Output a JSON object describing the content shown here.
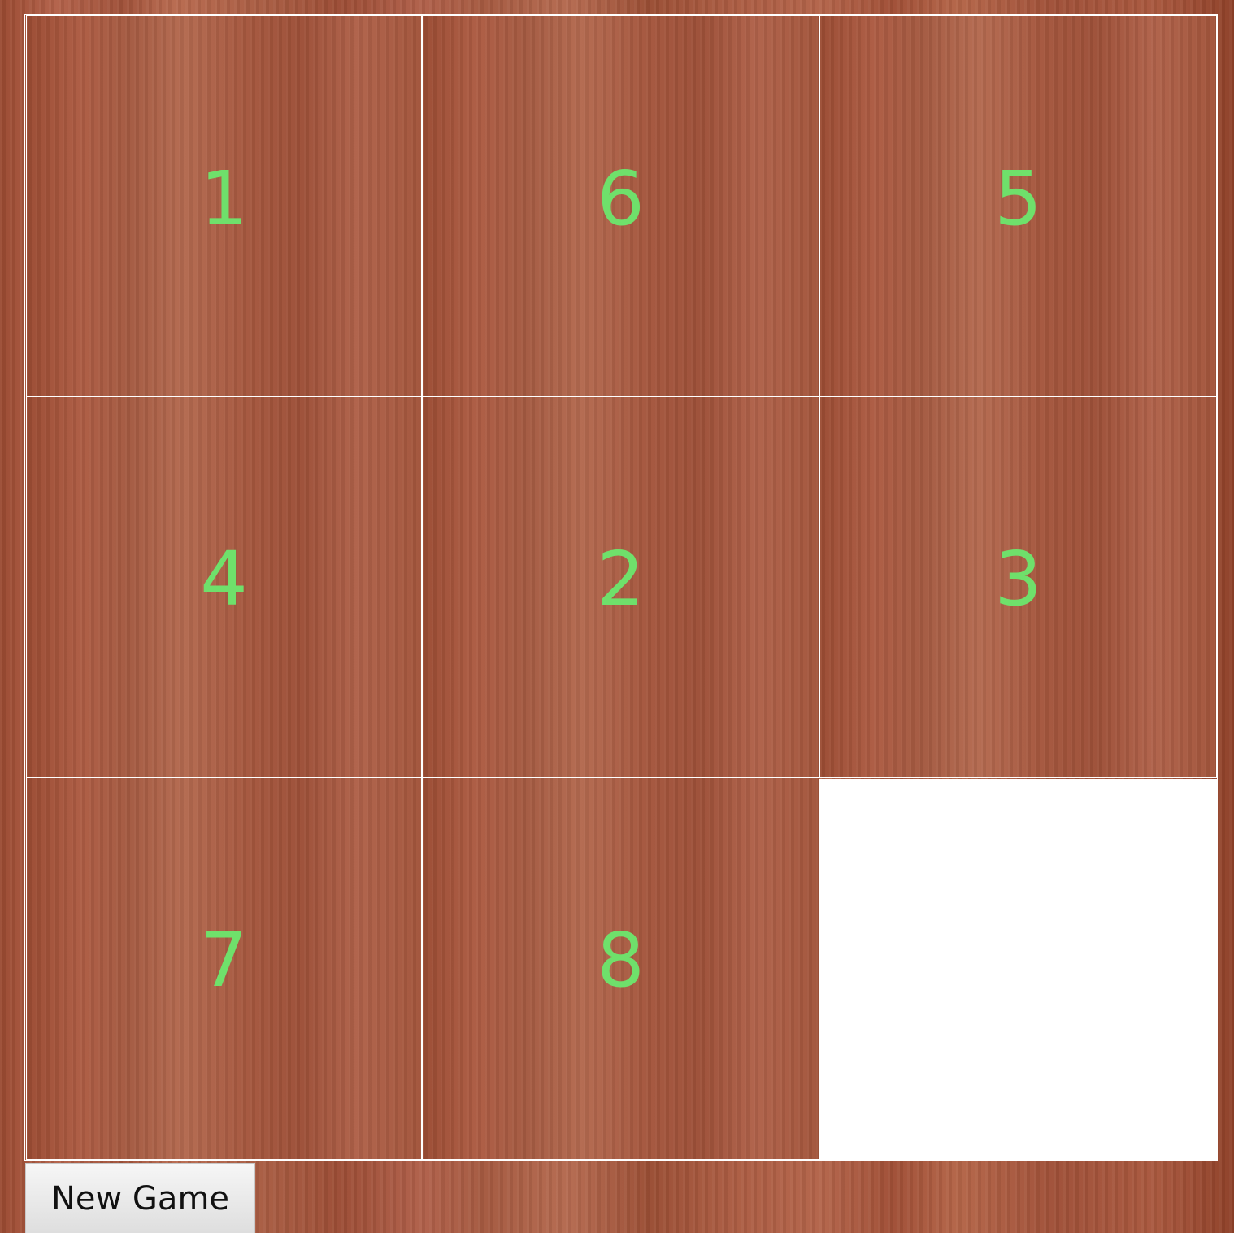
{
  "puzzle": {
    "size": 3,
    "tiles": [
      "1",
      "6",
      "5",
      "4",
      "2",
      "3",
      "7",
      "8",
      ""
    ],
    "empty_index": 8,
    "number_color": "#6fe06b",
    "border_color": "#ffffff"
  },
  "controls": {
    "new_game_label": "New Game"
  }
}
